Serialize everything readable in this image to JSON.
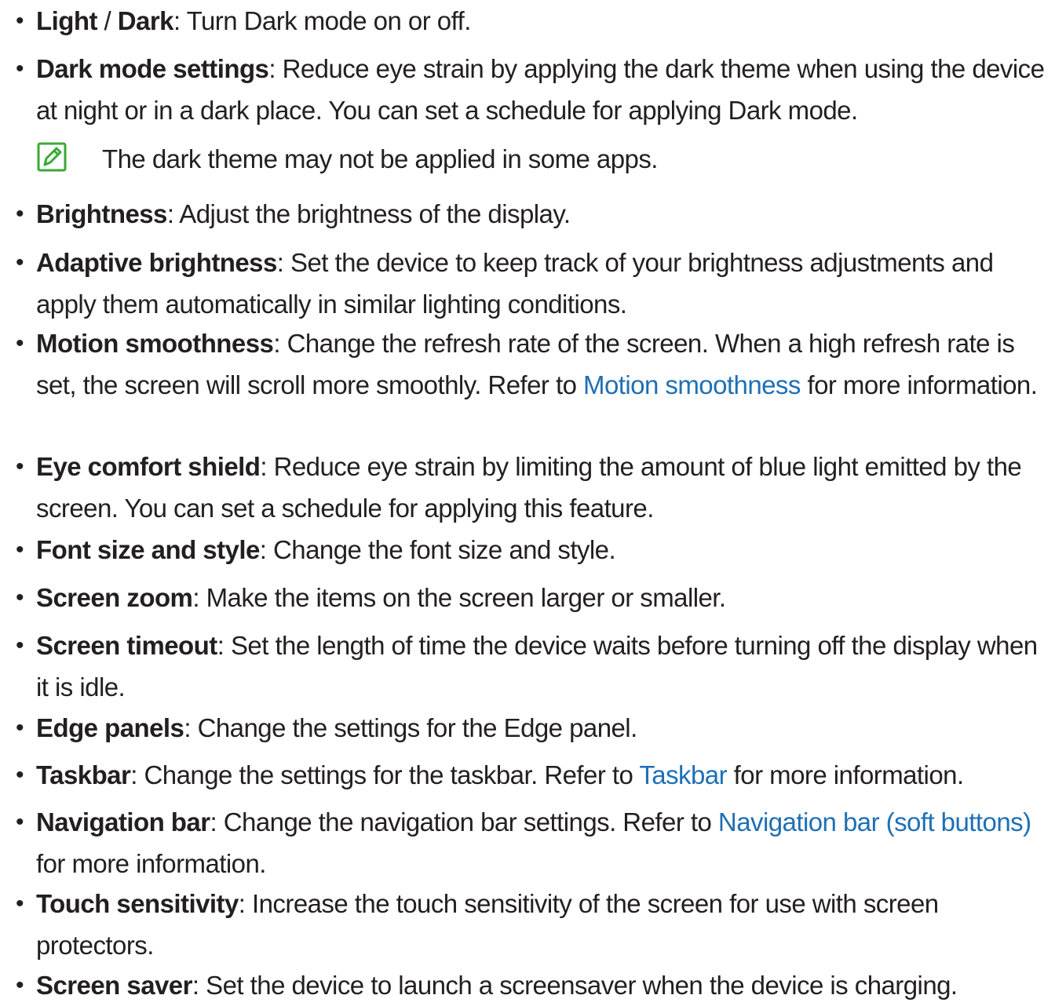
{
  "items": [
    {
      "parts": [
        {
          "b": "Light"
        },
        {
          "t": " / "
        },
        {
          "b": "Dark"
        },
        {
          "t": ": Turn Dark mode on or off."
        }
      ]
    },
    {
      "parts": [
        {
          "b": "Dark mode settings"
        },
        {
          "t": ": Reduce eye strain by applying the dark theme when using the device at night or in a dark place. You can set a schedule for applying Dark mode."
        }
      ]
    },
    {
      "parts": [
        {
          "b": "Brightness"
        },
        {
          "t": ": Adjust the brightness of the display."
        }
      ]
    },
    {
      "parts": [
        {
          "b": "Adaptive brightness"
        },
        {
          "t": ": Set the device to keep track of your brightness adjustments and apply them automatically in similar lighting conditions."
        }
      ]
    },
    {
      "parts": [
        {
          "b": "Motion smoothness"
        },
        {
          "t": ": Change the refresh rate of the screen. When a high refresh rate is set, the screen will scroll more smoothly. Refer to "
        },
        {
          "l": "Motion smoothness"
        },
        {
          "t": " for more information."
        }
      ]
    },
    {
      "parts": [
        {
          "b": "Eye comfort shield"
        },
        {
          "t": ": Reduce eye strain by limiting the amount of blue light emitted by the screen. You can set a schedule for applying this feature."
        }
      ]
    },
    {
      "parts": [
        {
          "b": "Font size and style"
        },
        {
          "t": ": Change the font size and style."
        }
      ]
    },
    {
      "parts": [
        {
          "b": "Screen zoom"
        },
        {
          "t": ": Make the items on the screen larger or smaller."
        }
      ]
    },
    {
      "parts": [
        {
          "b": "Screen timeout"
        },
        {
          "t": ": Set the length of time the device waits before turning off the display when it is idle."
        }
      ]
    },
    {
      "parts": [
        {
          "b": "Edge panels"
        },
        {
          "t": ": Change the settings for the Edge panel."
        }
      ]
    },
    {
      "parts": [
        {
          "b": "Taskbar"
        },
        {
          "t": ": Change the settings for the taskbar. Refer to "
        },
        {
          "l": "Taskbar"
        },
        {
          "t": " for more information."
        }
      ]
    },
    {
      "parts": [
        {
          "b": "Navigation bar"
        },
        {
          "t": ": Change the navigation bar settings. Refer to "
        },
        {
          "l": "Navigation bar (soft buttons)"
        },
        {
          "t": " for more information."
        }
      ]
    },
    {
      "parts": [
        {
          "b": "Touch sensitivity"
        },
        {
          "t": ": Increase the touch sensitivity of the screen for use with screen protectors."
        }
      ]
    },
    {
      "parts": [
        {
          "b": "Screen saver"
        },
        {
          "t": ": Set the device to launch a screensaver when the device is charging."
        }
      ]
    }
  ],
  "note": {
    "text": "The dark theme may not be applied in some apps.",
    "icon": "note-pencil-icon"
  },
  "colors": {
    "text": "#231f20",
    "link": "#1e6fb5",
    "note_icon": "#3aa935"
  }
}
